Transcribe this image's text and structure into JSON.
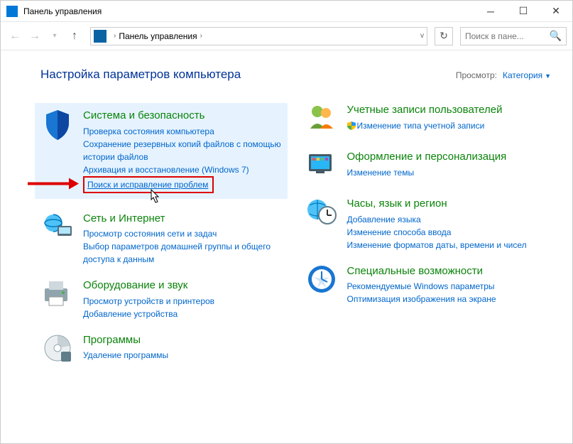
{
  "title": "Панель управления",
  "breadcrumb": {
    "root": "Панель управления"
  },
  "search": {
    "placeholder": "Поиск в пане..."
  },
  "heading": "Настройка параметров компьютера",
  "view": {
    "label": "Просмотр:",
    "value": "Категория"
  },
  "left": [
    {
      "title": "Система и безопасность",
      "links": [
        "Проверка состояния компьютера",
        "Сохранение резервных копий файлов с помощью истории файлов",
        "Архивация и восстановление (Windows 7)",
        "Поиск и исправление проблем"
      ],
      "highlight": true,
      "boxedIndex": 3
    },
    {
      "title": "Сеть и Интернет",
      "links": [
        "Просмотр состояния сети и задач",
        "Выбор параметров домашней группы и общего доступа к данным"
      ]
    },
    {
      "title": "Оборудование и звук",
      "links": [
        "Просмотр устройств и принтеров",
        "Добавление устройства"
      ]
    },
    {
      "title": "Программы",
      "links": [
        "Удаление программы"
      ]
    }
  ],
  "right": [
    {
      "title": "Учетные записи пользователей",
      "links": [
        "Изменение типа учетной записи"
      ],
      "shield": true
    },
    {
      "title": "Оформление и персонализация",
      "links": [
        "Изменение темы"
      ]
    },
    {
      "title": "Часы, язык и регион",
      "links": [
        "Добавление языка",
        "Изменение способа ввода",
        "Изменение форматов даты, времени и чисел"
      ]
    },
    {
      "title": "Специальные возможности",
      "links": [
        "Рекомендуемые Windows параметры",
        "Оптимизация изображения на экране"
      ]
    }
  ]
}
